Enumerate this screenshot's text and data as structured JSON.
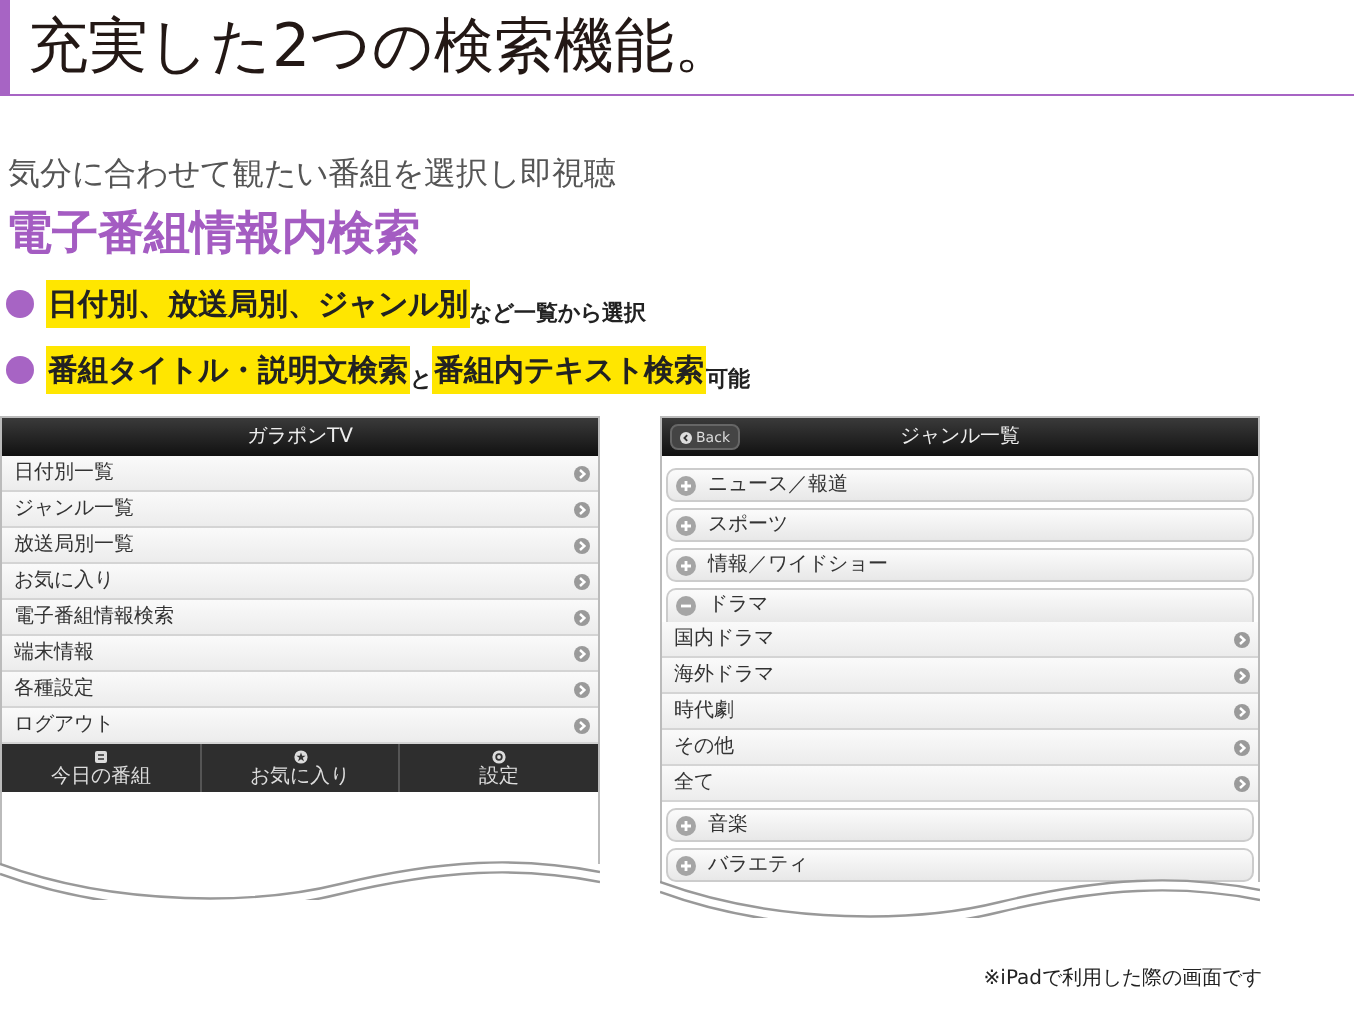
{
  "heading": "充実した2つの検索機能。",
  "subtitle": "気分に合わせて観たい番組を選択し即視聴",
  "feature_title": "電子番組情報内検索",
  "bullets": [
    {
      "segments": [
        {
          "text": "日付別、放送局別、ジャンル別",
          "highlight": true
        },
        {
          "text": "など一覧から選択",
          "highlight": false
        }
      ]
    },
    {
      "segments": [
        {
          "text": "番組タイトル・説明文検索",
          "highlight": true
        },
        {
          "text": "と",
          "highlight": false
        },
        {
          "text": "番組内テキスト検索",
          "highlight": true
        },
        {
          "text": "可能",
          "highlight": false
        }
      ]
    }
  ],
  "screens": [
    {
      "title": "ガラポンTV",
      "items": [
        {
          "kind": "link",
          "label": "日付別一覧"
        },
        {
          "kind": "link",
          "label": "ジャンル一覧"
        },
        {
          "kind": "link",
          "label": "放送局別一覧"
        },
        {
          "kind": "link",
          "label": "お気に入り"
        },
        {
          "kind": "link",
          "label": "電子番組情報検索"
        },
        {
          "kind": "link",
          "label": "端末情報"
        },
        {
          "kind": "link",
          "label": "各種設定"
        },
        {
          "kind": "link",
          "label": "ログアウト"
        }
      ],
      "tab_bar": [
        {
          "label": "今日の番組"
        },
        {
          "label": "お気に入り"
        },
        {
          "label": "設定"
        }
      ]
    },
    {
      "title": "ジャンル一覧",
      "back_button": "Back",
      "items": [
        {
          "kind": "group",
          "label": "ニュース／報道",
          "expanded": false
        },
        {
          "kind": "group",
          "label": "スポーツ",
          "expanded": false
        },
        {
          "kind": "group",
          "label": "情報／ワイドショー",
          "expanded": false
        },
        {
          "kind": "group",
          "label": "ドラマ",
          "expanded": true,
          "children": [
            {
              "label": "国内ドラマ"
            },
            {
              "label": "海外ドラマ"
            },
            {
              "label": "時代劇"
            },
            {
              "label": "その他"
            },
            {
              "label": "全て"
            }
          ]
        },
        {
          "kind": "group",
          "label": "音楽",
          "expanded": false
        },
        {
          "kind": "group",
          "label": "バラエティ",
          "expanded": false
        }
      ]
    }
  ],
  "footnote": "※iPadで利用した際の画面です"
}
